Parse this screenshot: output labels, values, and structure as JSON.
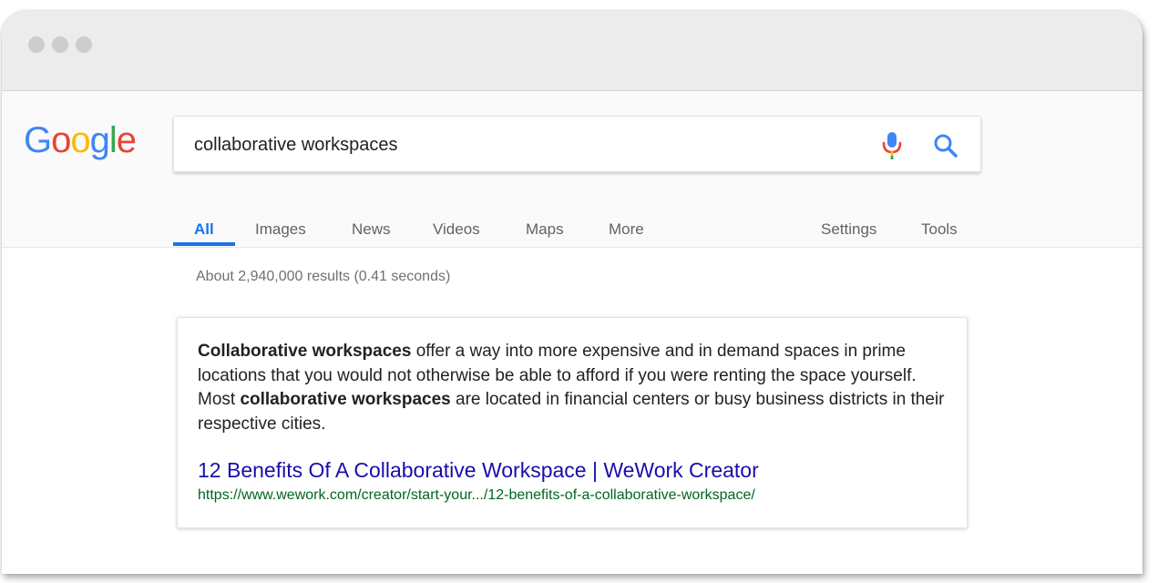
{
  "search": {
    "query": "collaborative workspaces"
  },
  "logo": {
    "letters": [
      "G",
      "o",
      "o",
      "g",
      "l",
      "e"
    ],
    "colors": [
      "#4285F4",
      "#EA4335",
      "#FBBC05",
      "#4285F4",
      "#34A853",
      "#EA4335"
    ]
  },
  "tabs": {
    "all": "All",
    "images": "Images",
    "news": "News",
    "videos": "Videos",
    "maps": "Maps",
    "more": "More",
    "settings": "Settings",
    "tools": "Tools"
  },
  "stats": "About 2,940,000 results (0.41 seconds)",
  "featured": {
    "snippet": [
      {
        "text": "Collaborative workspaces",
        "bold": true
      },
      {
        "text": " offer a way into more expensive and in demand spaces in prime locations that you would not otherwise be able to afford if you were renting the space yourself. Most ",
        "bold": false
      },
      {
        "text": "collaborative workspaces",
        "bold": true
      },
      {
        "text": " are located in financial centers or busy business districts in their respective cities.",
        "bold": false
      }
    ],
    "title": "12 Benefits Of A Collaborative Workspace | WeWork Creator",
    "url": "https://www.wework.com/creator/start-your.../12-benefits-of-a-collaborative-workspace/"
  },
  "colors": {
    "accent": "#1a73e8",
    "link": "#1a0dab",
    "url": "#006621",
    "mic_blue": "#4285F4",
    "mic_red": "#EA4335",
    "mic_yellow": "#FBBC05",
    "mic_green": "#34A853"
  },
  "icons": {
    "mic": "microphone-icon",
    "search": "magnifier-icon"
  }
}
